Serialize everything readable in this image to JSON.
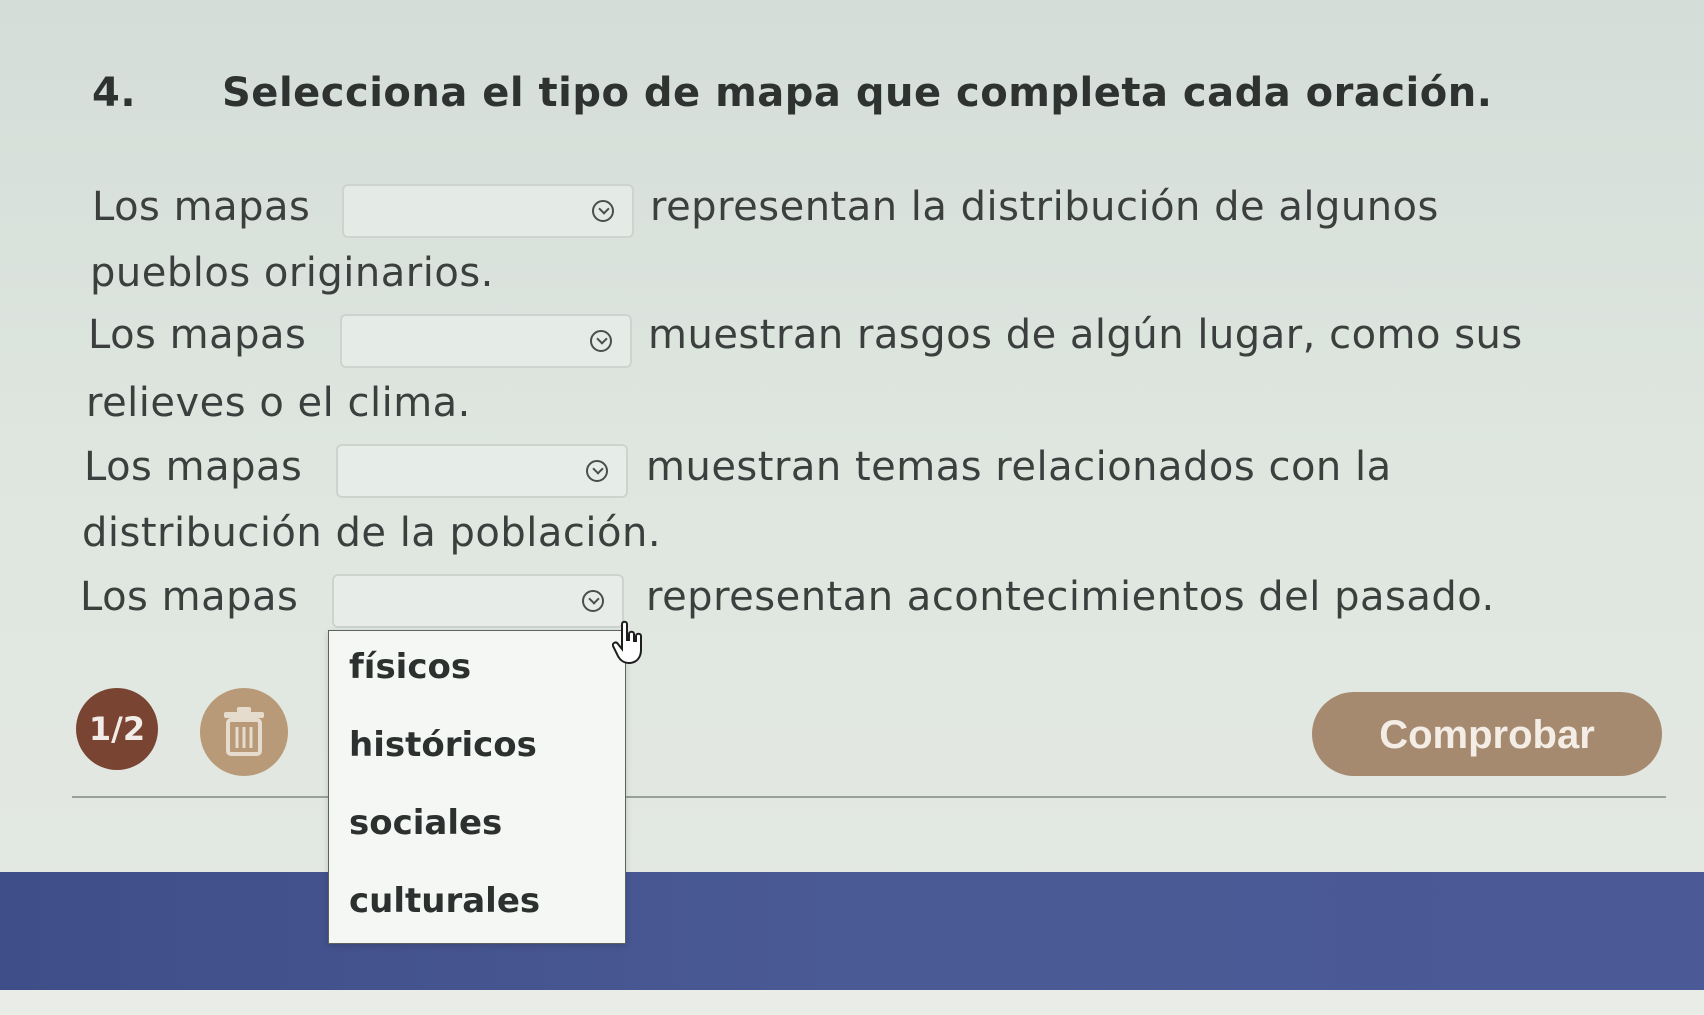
{
  "question": {
    "number": "4.",
    "text": "Selecciona el tipo de mapa que completa cada oración."
  },
  "sentences": [
    {
      "prefix": "Los mapas",
      "suffix": "representan la distribución de algunos",
      "continuation": "pueblos originarios."
    },
    {
      "prefix": "Los mapas",
      "suffix": "muestran rasgos de algún lugar, como sus",
      "continuation": "relieves o el clima."
    },
    {
      "prefix": "Los mapas",
      "suffix": "muestran temas relacionados con la",
      "continuation": "distribución de la población."
    },
    {
      "prefix": "Los mapas",
      "suffix": "representan acontecimientos del pasado."
    }
  ],
  "dropdown_options": [
    "físicos",
    "históricos",
    "sociales",
    "culturales"
  ],
  "footer": {
    "page_indicator": "1/2",
    "check_button": "Comprobar"
  },
  "icons": {
    "select_chevron": "chevron-down-circle-icon",
    "trash": "trash-icon"
  },
  "colors": {
    "badge": "#7a4433",
    "trash_button": "#b89a78",
    "check_button": "#a58a6f",
    "footer_band": "#4a5a95"
  }
}
